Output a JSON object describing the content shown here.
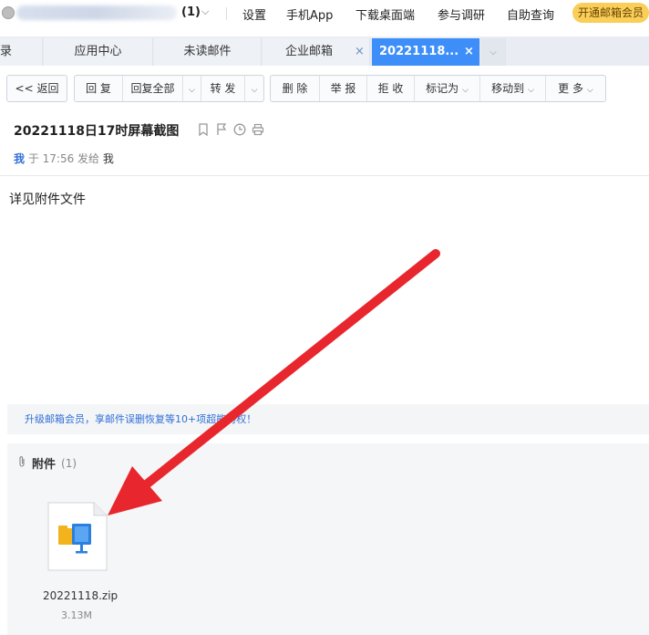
{
  "topbar": {
    "unread_count": "(1)",
    "links": [
      "设置",
      "手机App",
      "下载桌面端",
      "参与调研",
      "自助查询"
    ],
    "vip_button": "开通邮箱会员"
  },
  "tabs": [
    {
      "label": "录"
    },
    {
      "label": "应用中心"
    },
    {
      "label": "未读邮件"
    },
    {
      "label": "企业邮箱"
    },
    {
      "label": "20221118..."
    }
  ],
  "toolbar": {
    "back": "<< 返回",
    "reply": "回 复",
    "reply_all": "回复全部",
    "forward": "转 发",
    "delete": "删 除",
    "report": "举 报",
    "reject": "拒 收",
    "mark_as": "标记为",
    "move_to": "移动到",
    "more": "更 多"
  },
  "email": {
    "subject": "20221118日17时屏幕截图",
    "sender": "我",
    "time_prefix": "于 17:56 发给",
    "recipient": "我",
    "body": "详见附件文件"
  },
  "promo": "升级邮箱会员，享邮件误删恢复等10+项超能特权！",
  "attachments": {
    "title": "附件",
    "count": "(1)",
    "files": [
      {
        "name": "20221118.zip",
        "size": "3.13M"
      }
    ]
  },
  "colors": {
    "active_tab": "#3d8ef8",
    "vip": "#f9cf5a",
    "annotation_arrow": "#e8262d",
    "link_blue": "#2f6fd6"
  }
}
